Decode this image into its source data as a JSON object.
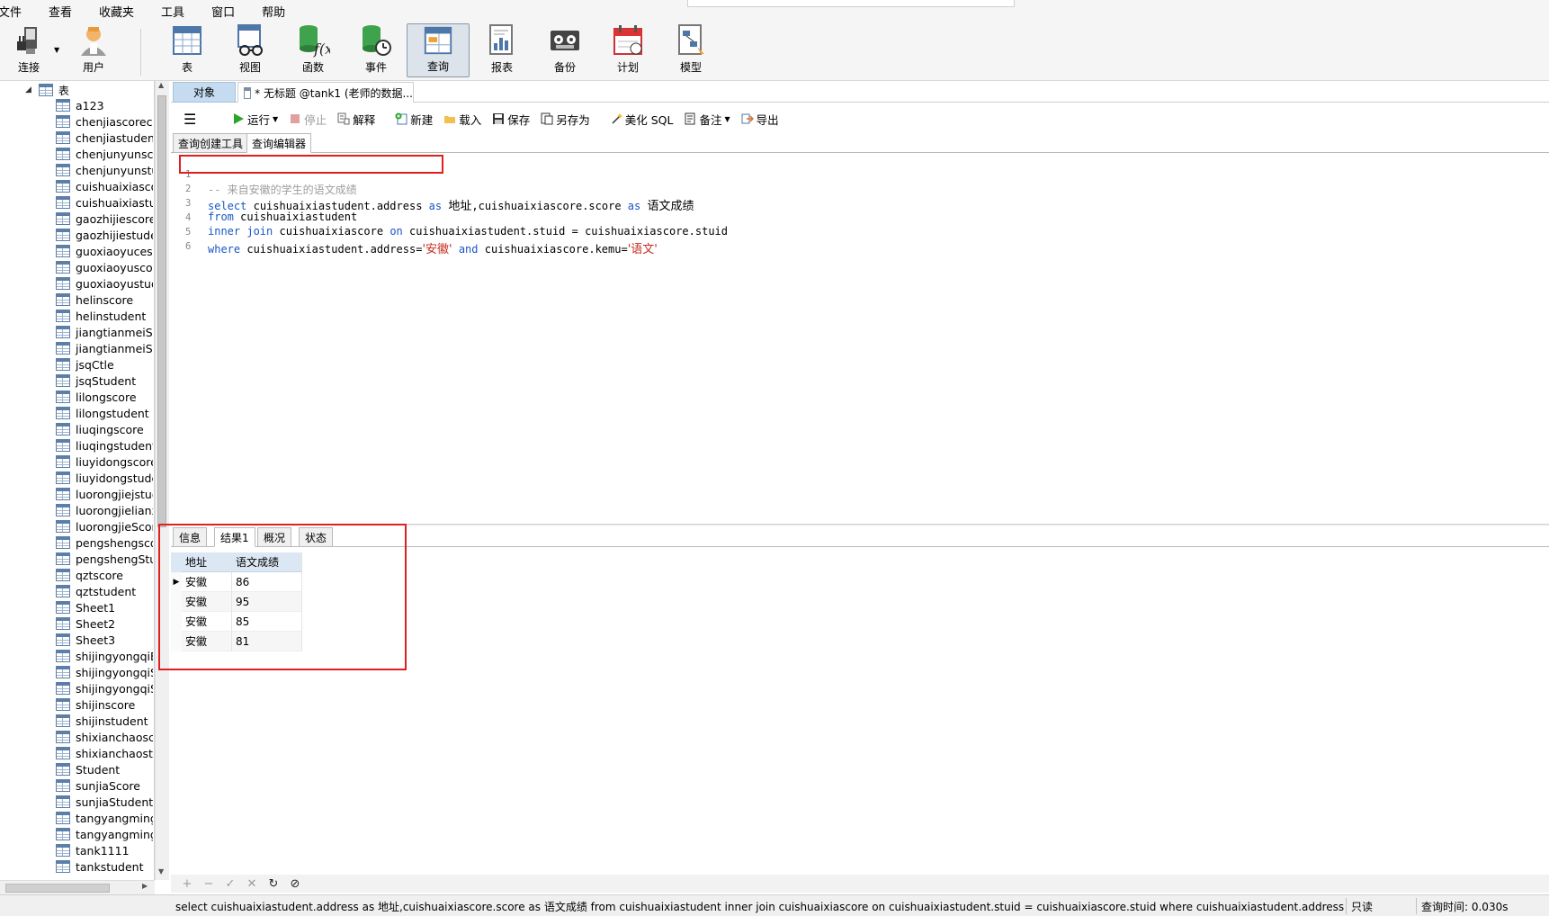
{
  "menu": [
    "文件",
    "查看",
    "收藏夹",
    "工具",
    "窗口",
    "帮助"
  ],
  "toolbar": [
    {
      "label": "连接",
      "icon": "plug-icon"
    },
    {
      "label": "用户",
      "icon": "user-icon"
    },
    {
      "label": "表",
      "icon": "table-icon"
    },
    {
      "label": "视图",
      "icon": "view-icon"
    },
    {
      "label": "函数",
      "icon": "function-icon"
    },
    {
      "label": "事件",
      "icon": "event-icon"
    },
    {
      "label": "查询",
      "icon": "query-icon",
      "active": true
    },
    {
      "label": "报表",
      "icon": "report-icon"
    },
    {
      "label": "备份",
      "icon": "backup-icon"
    },
    {
      "label": "计划",
      "icon": "schedule-icon"
    },
    {
      "label": "模型",
      "icon": "model-icon"
    }
  ],
  "tree": {
    "root": "表",
    "items": [
      "a123",
      "chenjiascorecc",
      "chenjiastudent",
      "chenjunyunsco",
      "chenjunyunstuc",
      "cuishuaixiascor",
      "cuishuaixiastuc",
      "gaozhijiescore",
      "gaozhijiestude",
      "guoxiaoyucesh",
      "guoxiaoyuscor",
      "guoxiaoyustud",
      "helinscore",
      "helinstudent",
      "jiangtianmeiSc",
      "jiangtianmeiStu",
      "jsqCtle",
      "jsqStudent",
      "lilongscore",
      "lilongstudent",
      "liuqingscore",
      "liuqingstudent",
      "liuyidongscore",
      "liuyidongstude",
      "luorongjiejstud",
      "luorongjielianx",
      "luorongjieScor",
      "pengshengsco",
      "pengshengStu",
      "qztscore",
      "qztstudent",
      "Sheet1",
      "Sheet2",
      "Sheet3",
      "shijingyongqiB",
      "shijingyongqiS",
      "shijingyongqiS",
      "shijinscore",
      "shijinstudent",
      "shixianchaoscc",
      "shixianchaostu",
      "Student",
      "sunjiaScore",
      "sunjiaStudent",
      "tangyangming",
      "tangyangming",
      "tank1111",
      "tankstudent"
    ]
  },
  "tabs": {
    "object": "对象",
    "query": "* 无标题 @tank1 (老师的数据..."
  },
  "editor_toolbar": {
    "run": "运行",
    "stop": "停止",
    "explain": "解释",
    "new": "新建",
    "load": "载入",
    "save": "保存",
    "save_as": "另存为",
    "beautify": "美化 SQL",
    "note": "备注",
    "export": "导出"
  },
  "subtabs": [
    "查询创建工具",
    "查询编辑器"
  ],
  "code": {
    "line_numbers": [
      "1",
      "2",
      "3",
      "4",
      "5",
      "6"
    ],
    "l1_comment": "-- 来自安徽的学生的语文成绩",
    "l2_select": "select",
    "l2_a": "cuishuaixiastudent.address",
    "l2_as1": "as",
    "l2_alias1": "地址",
    "l2_b": ",cuishuaixiascore.score",
    "l2_as2": "as",
    "l2_alias2": "语文成绩",
    "l3_from": "from",
    "l3_table": "cuishuaixiastudent",
    "l4_inner": "inner join",
    "l4_table": "cuishuaixiascore",
    "l4_on": "on",
    "l4_cond": "cuishuaixiastudent.stuid = cuishuaixiascore.stuid",
    "l5_where": "where",
    "l5_cond": "cuishuaixiastudent.address=",
    "l5_val1": "'安徽'",
    "l5_and": "and",
    "l5_cond2": "cuishuaixiascore.kemu=",
    "l5_val2": "'语文'"
  },
  "result_tabs": [
    "信息",
    "结果1",
    "概况",
    "状态"
  ],
  "result": {
    "columns": [
      "地址",
      "语文成绩"
    ],
    "rows": [
      [
        "安徽",
        "86"
      ],
      [
        "安徽",
        "95"
      ],
      [
        "安徽",
        "85"
      ],
      [
        "安徽",
        "81"
      ]
    ]
  },
  "status": {
    "sql": "select cuishuaixiastudent.address as 地址,cuishuaixiascore.score as 语文成绩 from cuishuaixiastudent  inner join cuishuaixiascore on cuishuaixiastudent.stuid = cuishuaixiascore.stuid where cuishuaixiastudent.address='安徽' and",
    "readonly": "只读",
    "query_time": "查询时间: 0.030s"
  },
  "colors": {
    "keyword": "#1a56c6",
    "string": "#c42b1c",
    "comment": "#9e9e9e",
    "highlight": "#e02020"
  }
}
